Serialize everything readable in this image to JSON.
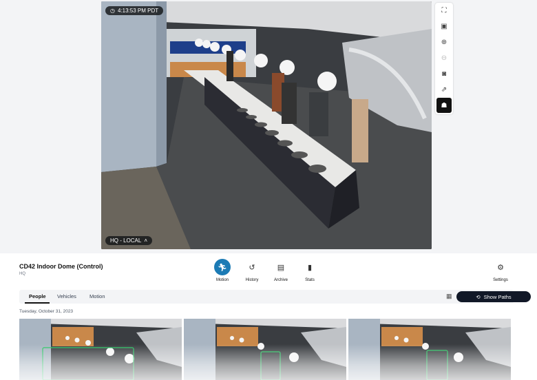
{
  "video": {
    "timestamp": "4:13:53 PM PDT",
    "location_label": "HQ - LOCAL"
  },
  "toolbar": {
    "icons": [
      "fullscreen-icon",
      "picture-in-picture-icon",
      "zoom-in-icon",
      "zoom-out-icon",
      "snapshot-icon",
      "share-icon",
      "person-tracking-icon"
    ]
  },
  "camera": {
    "name": "CD42 Indoor Dome (Control)",
    "site": "HQ"
  },
  "nav": {
    "motion": "Motion",
    "history": "History",
    "archive": "Archive",
    "stats": "Stats",
    "settings": "Settings"
  },
  "tabs": {
    "people": "People",
    "vehicles": "Vehicles",
    "motion": "Motion"
  },
  "show_paths_label": "Show Paths",
  "date_label": "Tuesday, October 31, 2023",
  "colors": {
    "accent": "#1c7bb5",
    "dark_button": "#111827",
    "detection_box": "#22c55e"
  }
}
